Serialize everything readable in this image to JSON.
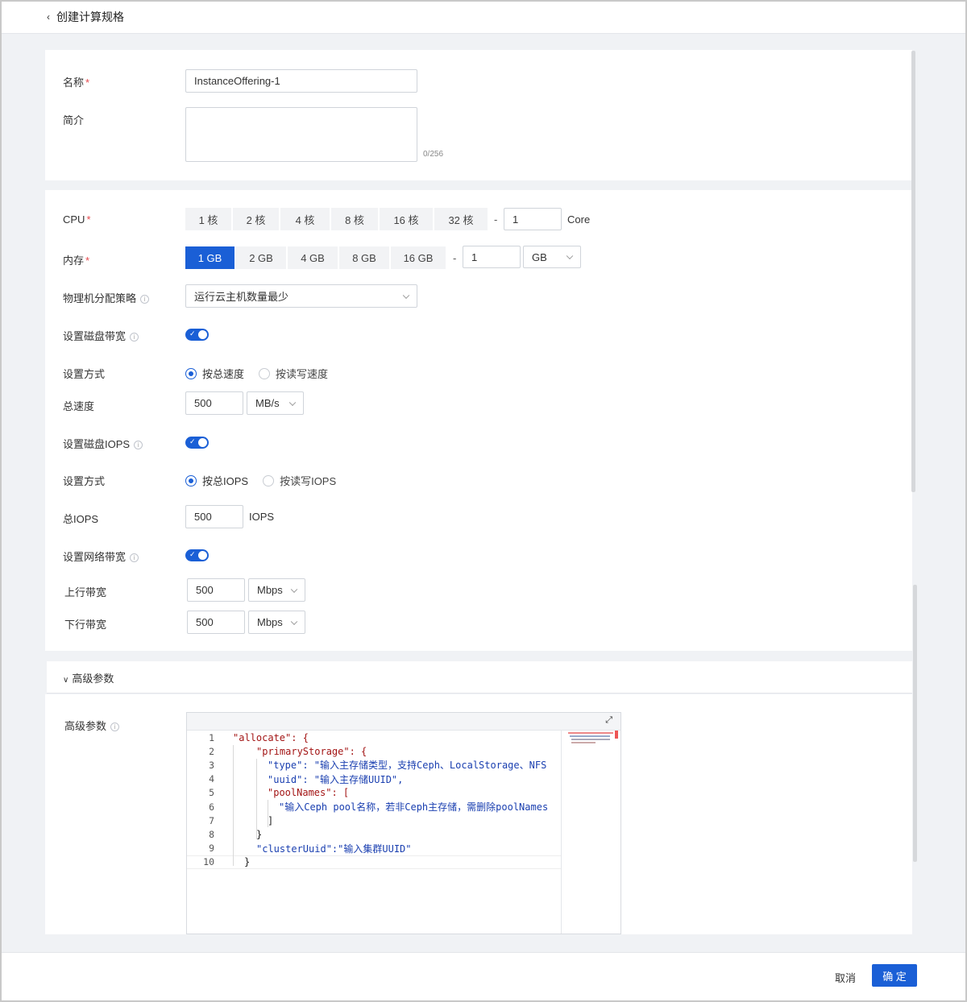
{
  "header": {
    "back_label": "创建计算规格"
  },
  "basic": {
    "name_label": "名称",
    "name_value": "InstanceOffering-1",
    "desc_label": "简介",
    "desc_count": "0/256"
  },
  "cpu": {
    "label": "CPU",
    "options": [
      "1 核",
      "2 核",
      "4 核",
      "8 核",
      "16 核",
      "32 核"
    ],
    "dash": "-",
    "value": "1",
    "unit": "Core"
  },
  "memory": {
    "label": "内存",
    "options": [
      "1 GB",
      "2 GB",
      "4 GB",
      "8 GB",
      "16 GB"
    ],
    "selected": "1 GB",
    "dash": "-",
    "value": "1",
    "unit": "GB"
  },
  "host_strategy": {
    "label": "物理机分配策略",
    "value": "运行云主机数量最少"
  },
  "disk_bandwidth": {
    "toggle_label": "设置磁盘带宽",
    "mode_label": "设置方式",
    "mode_options": [
      "按总速度",
      "按读写速度"
    ],
    "total_label": "总速度",
    "total_value": "500",
    "total_unit": "MB/s"
  },
  "disk_iops": {
    "toggle_label": "设置磁盘IOPS",
    "mode_label": "设置方式",
    "mode_options": [
      "按总IOPS",
      "按读写IOPS"
    ],
    "total_label": "总IOPS",
    "total_value": "500",
    "total_unit": "IOPS"
  },
  "network": {
    "toggle_label": "设置网络带宽",
    "up_label": "上行带宽",
    "up_value": "500",
    "up_unit": "Mbps",
    "down_label": "下行带宽",
    "down_value": "500",
    "down_unit": "Mbps"
  },
  "advanced": {
    "section_title": "高级参数",
    "field_label": "高级参数",
    "code_lines": [
      "\"allocate\": {",
      "\"primaryStorage\": {",
      "\"type\": \"输入主存储类型，支持Ceph、LocalStorage、NFS",
      "\"uuid\": \"输入主存储UUID\",",
      "\"poolNames\": [",
      "\"输入Ceph pool名称，若非Ceph主存储，需删除poolNames",
      "]",
      "}",
      "\"clusterUuid\":\"输入集群UUID\"",
      "}"
    ]
  },
  "footer": {
    "cancel": "取消",
    "ok": "确 定"
  },
  "colors": {
    "primary": "#1a5fd6",
    "required": "#e5484d"
  }
}
